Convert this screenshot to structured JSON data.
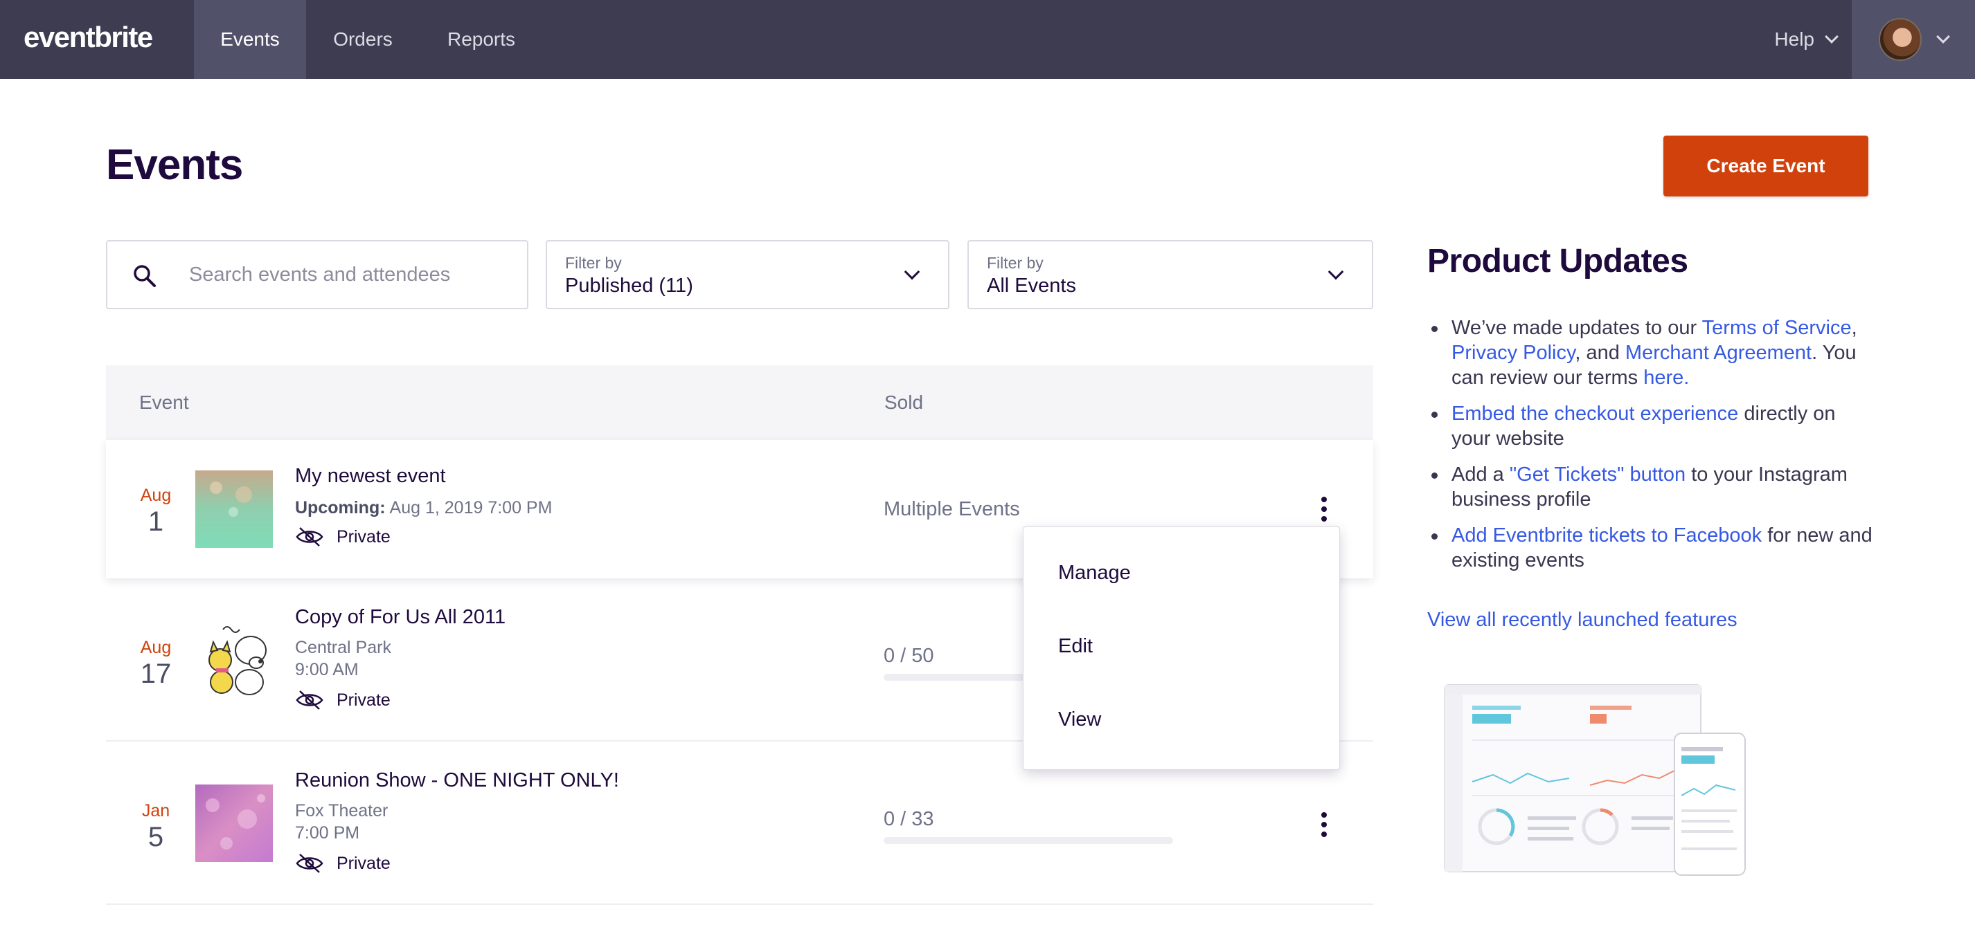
{
  "nav": {
    "logo": "eventbrite",
    "tabs": [
      "Events",
      "Orders",
      "Reports"
    ],
    "help": "Help"
  },
  "header": {
    "title": "Events",
    "create_button": "Create Event"
  },
  "search": {
    "placeholder": "Search events and attendees"
  },
  "filters": [
    {
      "label": "Filter by",
      "value": "Published (11)"
    },
    {
      "label": "Filter by",
      "value": "All Events"
    }
  ],
  "table": {
    "columns": [
      "Event",
      "Sold"
    ],
    "rows": [
      {
        "month": "Aug",
        "day": "1",
        "title": "My newest event",
        "status_label": "Upcoming:",
        "datetime": "Aug 1, 2019 7:00 PM",
        "visibility": "Private",
        "sold": "Multiple Events"
      },
      {
        "month": "Aug",
        "day": "17",
        "title": "Copy of For Us All 2011",
        "venue": "Central Park",
        "time": "9:00 AM",
        "visibility": "Private",
        "sold": "0 / 50",
        "sold_fraction": 0
      },
      {
        "month": "Jan",
        "day": "5",
        "title": "Reunion Show - ONE NIGHT ONLY!",
        "venue": "Fox Theater",
        "time": "7:00 PM",
        "visibility": "Private",
        "sold": "0 / 33",
        "sold_fraction": 0
      }
    ]
  },
  "row_menu": [
    "Manage",
    "Edit",
    "View"
  ],
  "product_updates": {
    "title": "Product Updates",
    "items": [
      {
        "t1": "We’ve made updates to our ",
        "l1": "Terms of Service",
        "t2": ", ",
        "l2": "Privacy Policy",
        "t3": ", and ",
        "l3": "Merchant Agreement",
        "t4": ". You can review our terms ",
        "l4": "here."
      },
      {
        "l1": "Embed the checkout experience",
        "t1": " directly on your website"
      },
      {
        "t1": "Add a ",
        "l1": "\"Get Tickets\" button",
        "t2": " to your Instagram business profile"
      },
      {
        "l1": "Add Eventbrite tickets to Facebook",
        "t1": " for new and existing events"
      }
    ],
    "view_all": "View all recently launched features"
  },
  "colors": {
    "nav_bg": "#3d3c51",
    "accent": "#d1410c",
    "link": "#3659e3",
    "text": "#1e0a3c"
  }
}
